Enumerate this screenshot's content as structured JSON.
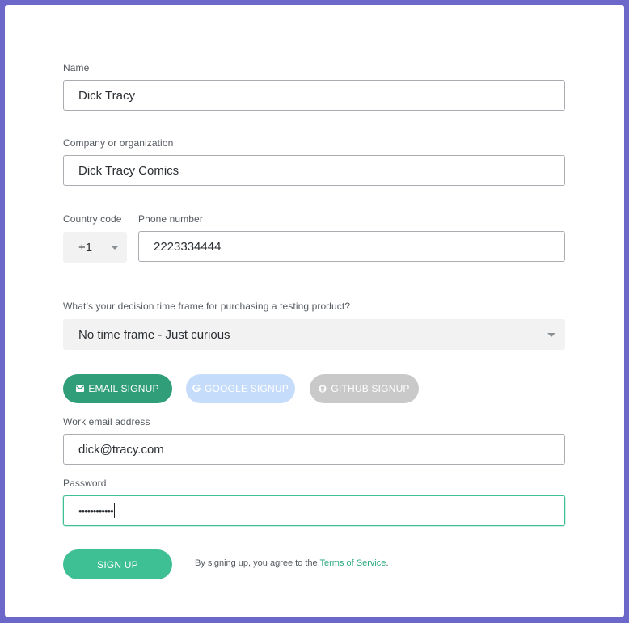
{
  "form": {
    "name": {
      "label": "Name",
      "value": "Dick Tracy"
    },
    "company": {
      "label": "Company or organization",
      "value": "Dick Tracy Comics"
    },
    "country_code": {
      "label": "Country code",
      "value": "+1"
    },
    "phone": {
      "label": "Phone number",
      "value": "2223334444"
    },
    "timeframe": {
      "label": "What’s your decision time frame for purchasing a testing product?",
      "value": "No time frame - Just curious"
    },
    "signup_methods": {
      "email": "EMAIL SIGNUP",
      "google": "GOOGLE SIGNUP",
      "github": "GITHUB SIGNUP"
    },
    "email": {
      "label": "Work email address",
      "value": "dick@tracy.com"
    },
    "password": {
      "label": "Password",
      "value": "••••••••••••"
    },
    "submit_label": "SIGN UP",
    "terms": {
      "prefix": "By signing up, you agree to the ",
      "link": "Terms of Service",
      "suffix": "."
    }
  },
  "colors": {
    "background": "#6c68c9",
    "accent": "#3fbf94",
    "email_button": "#2f9e79",
    "google_button": "#c6dcfb",
    "github_button": "#c9c9c9",
    "link": "#2aa981"
  },
  "icons": {
    "email": "envelope-icon",
    "google": "google-icon",
    "github": "github-icon",
    "dropdown": "chevron-down-icon"
  }
}
